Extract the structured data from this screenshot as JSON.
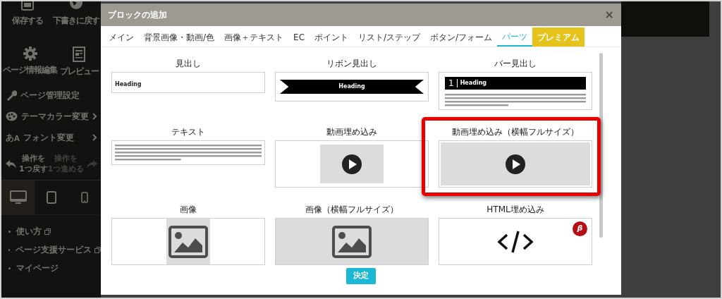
{
  "sidebar": {
    "top_buttons": [
      {
        "kind": "save",
        "label": "保存する"
      },
      {
        "kind": "revert",
        "label": "下書きに戻す"
      },
      {
        "kind": "settings",
        "label": "ページ情報編集"
      },
      {
        "kind": "preview",
        "label": "プレビュー"
      }
    ],
    "menu": [
      {
        "kind": "wrench",
        "label": "ページ管理設定",
        "has_submenu": false
      },
      {
        "kind": "palette",
        "label": "テーマカラー変更",
        "has_submenu": true
      },
      {
        "kind": "font",
        "glyph_main": "あ",
        "glyph_sub": "A",
        "label": "フォント変更",
        "has_submenu": true
      }
    ],
    "history": [
      {
        "kind": "undo",
        "lines": [
          "操作を",
          "1つ戻す"
        ],
        "disabled": false
      },
      {
        "kind": "redo",
        "lines": [
          "操作を",
          "1つ進める"
        ],
        "disabled": true
      }
    ],
    "devices": [
      {
        "kind": "desktop",
        "selected": true
      },
      {
        "kind": "tablet",
        "selected": false
      },
      {
        "kind": "phone",
        "selected": false
      }
    ],
    "links": [
      {
        "label": "使い方",
        "external": true
      },
      {
        "label": "ページ支援サービス",
        "external": true
      },
      {
        "label": "マイページ",
        "external": false
      }
    ]
  },
  "modal": {
    "title": "ブロックの追加",
    "close": "×",
    "tabs": [
      {
        "label": "メイン",
        "kind": "normal",
        "selected": false
      },
      {
        "label": "背景画像・動画/色",
        "kind": "normal",
        "selected": false
      },
      {
        "label": "画像＋テキスト",
        "kind": "normal",
        "selected": false
      },
      {
        "label": "EC",
        "kind": "normal",
        "selected": false
      },
      {
        "label": "ポイント",
        "kind": "normal",
        "selected": false
      },
      {
        "label": "リスト/ステップ",
        "kind": "normal",
        "selected": false
      },
      {
        "label": "ボタン/フォーム",
        "kind": "normal",
        "selected": false
      },
      {
        "label": "パーツ",
        "kind": "normal",
        "selected": true
      },
      {
        "label": "プレミアム",
        "kind": "premium",
        "selected": false
      }
    ],
    "blocks": [
      {
        "label": "見出し",
        "kind": "heading",
        "highlighted": false,
        "heading": "Heading"
      },
      {
        "label": "リボン見出し",
        "kind": "ribbon",
        "highlighted": false,
        "heading": "Heading"
      },
      {
        "label": "バー見出し",
        "kind": "bar",
        "highlighted": false,
        "number": "1",
        "heading": "Heading"
      },
      {
        "label": "テキスト",
        "kind": "text",
        "highlighted": false
      },
      {
        "label": "動画埋め込み",
        "kind": "video",
        "highlighted": false
      },
      {
        "label": "動画埋め込み（横幅フルサイズ）",
        "kind": "video-full",
        "highlighted": true
      },
      {
        "label": "画像",
        "kind": "image",
        "highlighted": false
      },
      {
        "label": "画像（横幅フルサイズ）",
        "kind": "image-full",
        "highlighted": false
      },
      {
        "label": "HTML埋め込み",
        "kind": "html",
        "highlighted": false,
        "badge": "β"
      }
    ],
    "confirm_button": "決定"
  }
}
